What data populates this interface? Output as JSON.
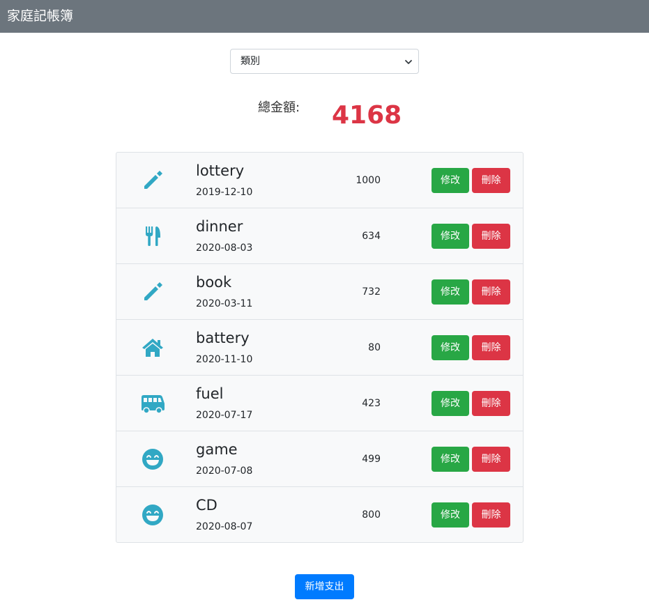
{
  "navbar": {
    "title": "家庭記帳簿"
  },
  "filter": {
    "selected": "類別"
  },
  "summary": {
    "total_label": "總金額:",
    "total_value": "4168"
  },
  "buttons": {
    "edit": "修改",
    "delete": "刪除",
    "add": "新增支出"
  },
  "colors": {
    "icon": "#31a8c4",
    "edit": "#28a745",
    "delete": "#dc3545",
    "primary": "#007bff",
    "navbar": "#6c757d"
  },
  "expenses": [
    {
      "icon": "pencil-icon",
      "name": "lottery",
      "date": "2019-12-10",
      "amount": "1000"
    },
    {
      "icon": "utensils-icon",
      "name": "dinner",
      "date": "2020-08-03",
      "amount": "634"
    },
    {
      "icon": "pencil-icon",
      "name": "book",
      "date": "2020-03-11",
      "amount": "732"
    },
    {
      "icon": "home-icon",
      "name": "battery",
      "date": "2020-11-10",
      "amount": "80"
    },
    {
      "icon": "bus-icon",
      "name": "fuel",
      "date": "2020-07-17",
      "amount": "423"
    },
    {
      "icon": "smile-icon",
      "name": "game",
      "date": "2020-07-08",
      "amount": "499"
    },
    {
      "icon": "smile-icon",
      "name": "CD",
      "date": "2020-08-07",
      "amount": "800"
    }
  ]
}
